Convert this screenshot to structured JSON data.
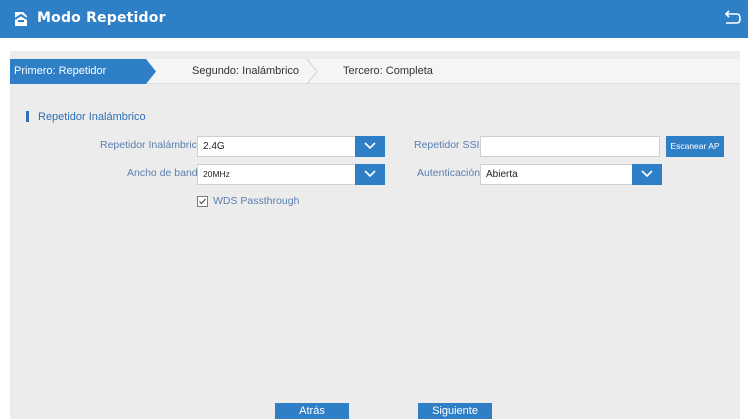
{
  "header": {
    "title": "Modo Repetidor",
    "logo_icon": "router-logo-icon",
    "back_icon": "return-arrow-icon"
  },
  "steps": [
    {
      "label": "Primero: Repetidor",
      "active": true
    },
    {
      "label": "Segundo: Inalámbrico",
      "active": false
    },
    {
      "label": "Tercero: Completa",
      "active": false
    }
  ],
  "section": {
    "title": "Repetidor Inalámbrico"
  },
  "form": {
    "wireless_repeater_label": "Repetidor Inalámbrico",
    "wireless_repeater_value": "2.4G",
    "bandwidth_label": "Ancho de banda",
    "bandwidth_value": "20MHz",
    "ssid_label": "Repetidor SSID",
    "ssid_value": "",
    "scan_button": "Escanear AP",
    "auth_label": "Autenticación",
    "auth_value": "Abierta",
    "wds_label": "WDS Passthrough",
    "wds_checked": true
  },
  "buttons": {
    "back": "Atrás",
    "next": "Siguiente"
  },
  "colors": {
    "accent": "#2f7fc7",
    "label": "#5a7fb0",
    "panel": "#ececec"
  }
}
